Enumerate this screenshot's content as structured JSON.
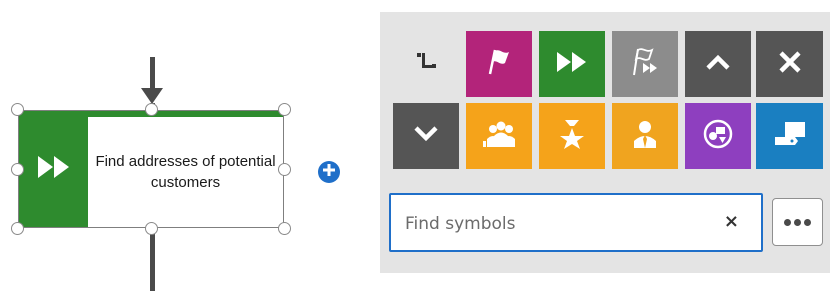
{
  "canvas": {
    "activity": {
      "label": "Find addresses of potential customers",
      "type_icon": "fast-forward-icon",
      "color": "#2e8b2e"
    },
    "add_button_icon": "plus-icon"
  },
  "palette": {
    "tiles": [
      {
        "name": "connection-tool-tile",
        "icon": "connector-icon",
        "color": "#e4e4e4"
      },
      {
        "name": "event-tile",
        "icon": "flag-icon",
        "color": "#b3247a"
      },
      {
        "name": "function-tile",
        "icon": "fast-forward-icon",
        "color": "#2e8b2e"
      },
      {
        "name": "process-interface-tile",
        "icon": "flag-forward-icon",
        "color": "#8c8c8c"
      },
      {
        "name": "scroll-up-tile",
        "icon": "chevron-up-icon",
        "color": "#555555"
      },
      {
        "name": "close-tile",
        "icon": "close-icon",
        "color": "#555555"
      },
      {
        "name": "scroll-down-tile",
        "icon": "chevron-down-icon",
        "color": "#555555"
      },
      {
        "name": "group-tile",
        "icon": "group-icon",
        "color": "#f5a31a"
      },
      {
        "name": "role-tile",
        "icon": "role-star-icon",
        "color": "#f5a31a"
      },
      {
        "name": "person-tile",
        "icon": "person-icon",
        "color": "#f0a41f"
      },
      {
        "name": "application-tile",
        "icon": "application-icon",
        "color": "#8e3fbf"
      },
      {
        "name": "it-system-tile",
        "icon": "it-system-icon",
        "color": "#1a7fc1"
      }
    ],
    "search": {
      "placeholder": "Find symbols",
      "clear_icon": "×"
    },
    "more_button_icon": "ellipsis-icon"
  }
}
